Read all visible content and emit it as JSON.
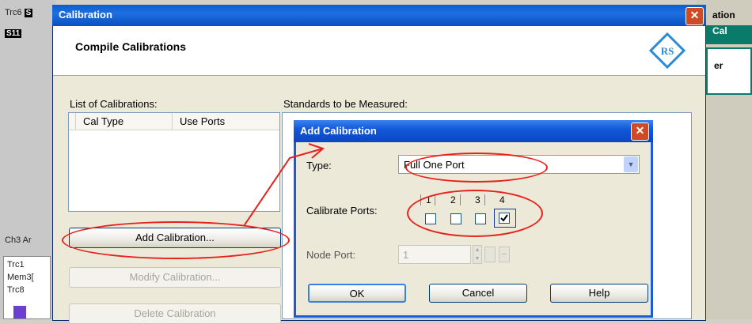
{
  "background_app": {
    "left_top": [
      "Trc6",
      "S"
    ],
    "left_s11": "S11",
    "left_ch3": "Ch3 Ar",
    "left_traces": [
      "Trc1",
      "Mem3[",
      "Trc8"
    ],
    "right_top": "ation",
    "right_cal": "Cal",
    "right_er": "er"
  },
  "main_window": {
    "title": "Calibration",
    "heading": "Compile Calibrations",
    "list_label": "List of Calibrations:",
    "columns": [
      "Cal Type",
      "Use Ports"
    ],
    "standards_label": "Standards to be Measured:",
    "buttons": {
      "add": "Add Calibration...",
      "modify": "Modify Calibration...",
      "delete": "Delete Calibration"
    }
  },
  "dialog": {
    "title": "Add Calibration",
    "type_label": "Type:",
    "type_value": "Full One Port",
    "ports_label": "Calibrate Ports:",
    "ports": [
      {
        "label": "1",
        "checked": false
      },
      {
        "label": "2",
        "checked": false
      },
      {
        "label": "3",
        "checked": false
      },
      {
        "label": "4",
        "checked": true
      }
    ],
    "node_label": "Node Port:",
    "node_value": "1",
    "buttons": {
      "ok": "OK",
      "cancel": "Cancel",
      "help": "Help"
    }
  },
  "colors": {
    "annotation_red": "#e8201c",
    "title_blue": "#0a5ed0"
  }
}
